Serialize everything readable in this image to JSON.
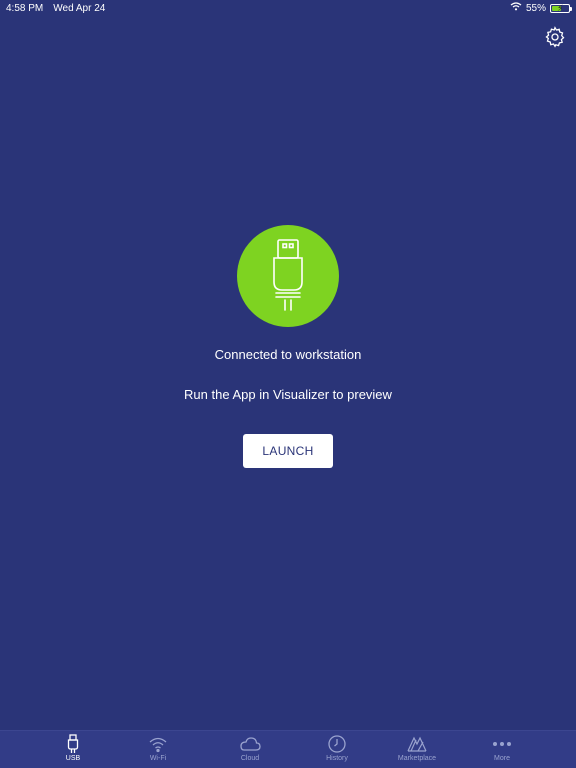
{
  "status_bar": {
    "time": "4:58 PM",
    "date": "Wed Apr 24",
    "battery_percent": "55%",
    "battery_level": 0.55
  },
  "main": {
    "status_title": "Connected to workstation",
    "status_subtitle": "Run the App in Visualizer to preview",
    "launch_label": "LAUNCH"
  },
  "colors": {
    "background": "#2a3478",
    "accent_green": "#7ed321",
    "tab_bar": "#323c87"
  },
  "tabs": [
    {
      "label": "USB",
      "icon": "usb-icon",
      "active": true
    },
    {
      "label": "Wi-Fi",
      "icon": "wifi-icon",
      "active": false
    },
    {
      "label": "Cloud",
      "icon": "cloud-icon",
      "active": false
    },
    {
      "label": "History",
      "icon": "clock-icon",
      "active": false
    },
    {
      "label": "Marketplace",
      "icon": "marketplace-icon",
      "active": false
    },
    {
      "label": "More",
      "icon": "more-icon",
      "active": false
    }
  ]
}
